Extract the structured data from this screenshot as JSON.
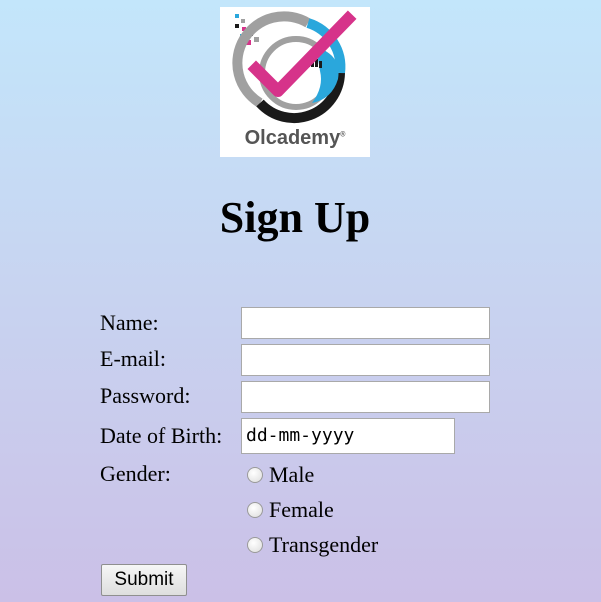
{
  "logo": {
    "text": "Olcademy",
    "registered": "®"
  },
  "page": {
    "title": "Sign Up"
  },
  "form": {
    "name_label": "Name:",
    "name_value": "",
    "email_label": "E-mail:",
    "email_value": "",
    "password_label": "Password:",
    "password_value": "",
    "dob_label": "Date of Birth:",
    "dob_placeholder": "dd-mm-yyyy",
    "gender_label": "Gender:",
    "gender_options": [
      "Male",
      "Female",
      "Transgender"
    ],
    "submit_label": "Submit"
  },
  "colors": {
    "logo_magenta": "#d6338a",
    "logo_blue": "#2aa7dc",
    "logo_gray": "#a0a0a0",
    "logo_black": "#1a1a1a"
  }
}
